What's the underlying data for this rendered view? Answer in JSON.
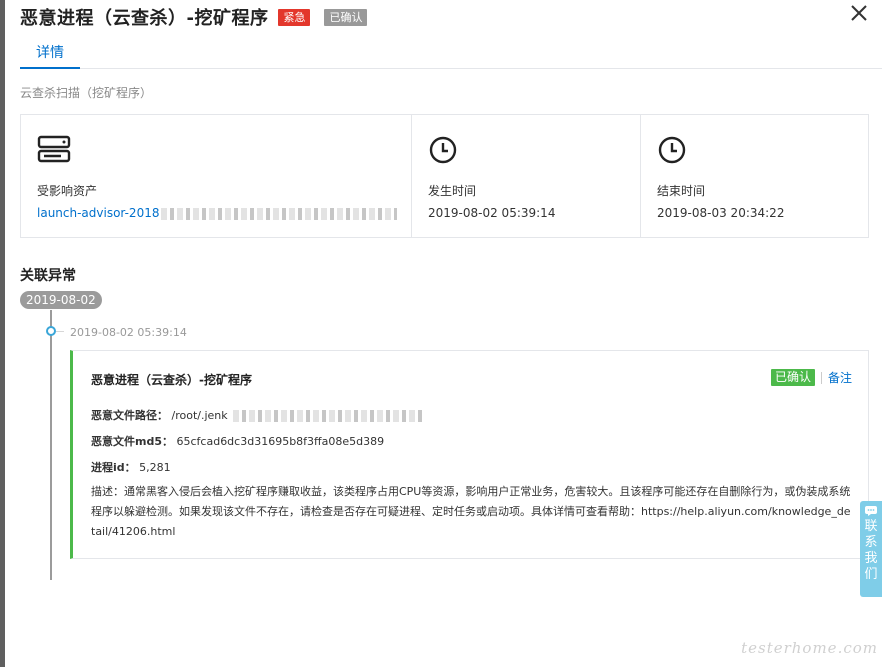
{
  "header": {
    "title": "恶意进程（云查杀）-挖矿程序",
    "severity_tag": "紧急",
    "status_tag": "已确认"
  },
  "tabs": [
    {
      "label": "详情"
    }
  ],
  "section_subtitle": "云查杀扫描（挖矿程序）",
  "info": {
    "asset": {
      "label": "受影响资产",
      "value": "launch-advisor-2018"
    },
    "start": {
      "label": "发生时间",
      "value": "2019-08-02 05:39:14"
    },
    "end": {
      "label": "结束时间",
      "value": "2019-08-03 20:34:22"
    }
  },
  "related": {
    "title": "关联异常",
    "date": "2019-08-02",
    "event": {
      "time": "2019-08-02 05:39:14",
      "title": "恶意进程（云查杀）-挖矿程序",
      "status": "已确认",
      "note_label": "备注",
      "path_label": "恶意文件路径：",
      "path_value": "/root/.jenk",
      "md5_label": "恶意文件md5：",
      "md5_value": "65cfcad6dc3d31695b8f3ffa08e5d389",
      "pid_label": "进程id：",
      "pid_value": "5,281",
      "desc_label": "描述：",
      "desc_value": "通常黑客入侵后会植入挖矿程序赚取收益，该类程序占用CPU等资源，影响用户正常业务，危害较大。且该程序可能还存在自删除行为，或伪装成系统程序以躲避检测。如果发现该文件不存在，请检查是否存在可疑进程、定时任务或启动项。具体详情可查看帮助：https://help.aliyun.com/knowledge_detail/41206.html"
    }
  },
  "contact": {
    "label": "联系我们"
  },
  "watermark": "testerhome.com",
  "icons": {
    "close": "close-icon",
    "asset": "server-icon",
    "start": "clock-icon",
    "end": "clock-icon",
    "contact": "chat-icon"
  },
  "colors": {
    "primary": "#0070cc",
    "urgent": "#e3372c",
    "confirmed_gray": "#999999",
    "success": "#4cb94a",
    "timeline_dot": "#3aa6d8",
    "contact_tab": "#7fcde8"
  }
}
